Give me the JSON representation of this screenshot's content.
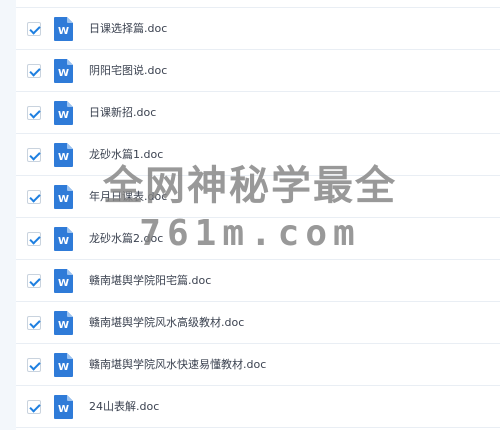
{
  "files": [
    {
      "name": "日课选择篇.doc",
      "checked": true,
      "icon": "word-doc-icon"
    },
    {
      "name": "阴阳宅图说.doc",
      "checked": true,
      "icon": "word-doc-icon"
    },
    {
      "name": "日课新招.doc",
      "checked": true,
      "icon": "word-doc-icon"
    },
    {
      "name": "龙砂水篇1.doc",
      "checked": true,
      "icon": "word-doc-icon"
    },
    {
      "name": "年月日课表.doc",
      "checked": true,
      "icon": "word-doc-icon"
    },
    {
      "name": "龙砂水篇2.doc",
      "checked": true,
      "icon": "word-doc-icon"
    },
    {
      "name": "赣南堪舆学院阳宅篇.doc",
      "checked": true,
      "icon": "word-doc-icon"
    },
    {
      "name": "赣南堪舆学院风水高级教材.doc",
      "checked": true,
      "icon": "word-doc-icon"
    },
    {
      "name": "赣南堪舆学院风水快速易懂教材.doc",
      "checked": true,
      "icon": "word-doc-icon"
    },
    {
      "name": "24山表解.doc",
      "checked": true,
      "icon": "word-doc-icon"
    }
  ],
  "watermark": {
    "line1": "全网神秘学最全",
    "line2": "761m.com"
  },
  "colors": {
    "icon_blue": "#2f7bd8",
    "check_blue": "#1e7fe0"
  }
}
